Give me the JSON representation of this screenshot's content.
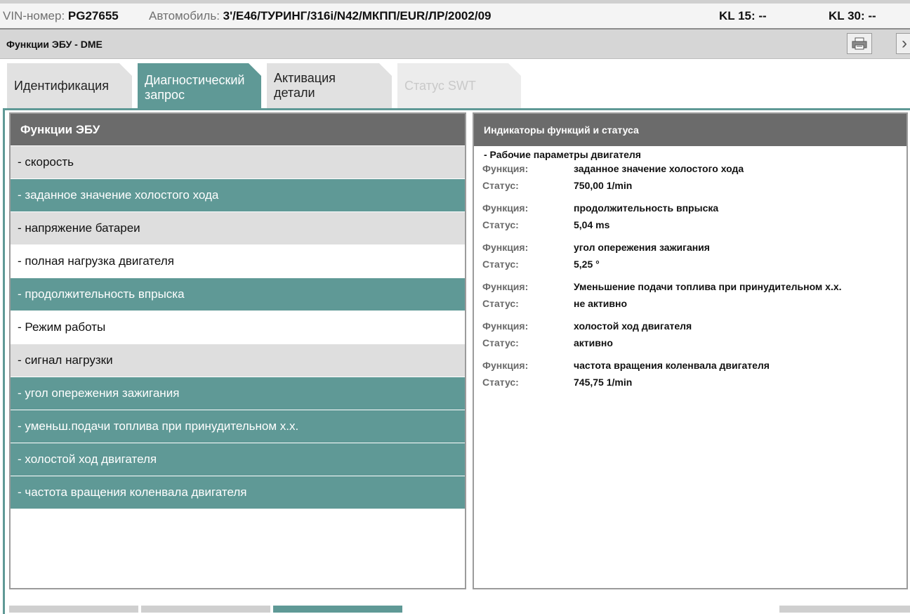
{
  "infobar": {
    "vin_label": "VIN-номер:",
    "vin_value": "PG27655",
    "car_label": "Автомобиль:",
    "car_value": "3'/E46/ТУРИНГ/316i/N42/МКПП/EUR/ЛР/2002/09",
    "kl15_label": "KL 15:",
    "kl15_value": "--",
    "kl30_label": "KL 30:",
    "kl30_value": "--"
  },
  "titlebar": {
    "title": "Функции ЭБУ - DME",
    "print_icon": "printer-icon",
    "next_icon": "chevron-right-icon"
  },
  "tabs": [
    {
      "label_line1": "Идентификация",
      "label_line2": "",
      "state": "normal"
    },
    {
      "label_line1": "Диагностический",
      "label_line2": "запрос",
      "state": "active"
    },
    {
      "label_line1": "Активация",
      "label_line2": "детали",
      "state": "normal"
    },
    {
      "label_line1": "Статус SWT",
      "label_line2": "",
      "state": "disabled"
    }
  ],
  "left_panel": {
    "header": "Функции ЭБУ",
    "items": [
      {
        "label": "- скорость",
        "state": "avail"
      },
      {
        "label": "- заданное значение холостого хода",
        "state": "sel"
      },
      {
        "label": "- напряжение батареи",
        "state": "avail"
      },
      {
        "label": "- полная нагрузка двигателя",
        "state": "plain"
      },
      {
        "label": "- продолжительность впрыска",
        "state": "sel"
      },
      {
        "label": "- Режим работы",
        "state": "plain"
      },
      {
        "label": "- сигнал нагрузки",
        "state": "avail"
      },
      {
        "label": "- угол опережения зажигания",
        "state": "sel"
      },
      {
        "label": "- уменьш.подачи топлива при принудительном х.х.",
        "state": "sel"
      },
      {
        "label": "- холостой ход двигателя",
        "state": "sel"
      },
      {
        "label": "- частота вращения коленвала двигателя",
        "state": "sel"
      }
    ]
  },
  "right_panel": {
    "header": "Индикаторы функций и статуса",
    "group_title": "- Рабочие параметры двигателя",
    "function_label": "Функция:",
    "status_label": "Статус:",
    "entries": [
      {
        "function": "заданное значение холостого хода",
        "status": "750,00  1/min"
      },
      {
        "function": "продолжительность впрыска",
        "status": "5,04  ms"
      },
      {
        "function": "угол опережения зажигания",
        "status": "5,25  °"
      },
      {
        "function": "Уменьшение подачи топлива при принудительном х.х.",
        "status": "не активно"
      },
      {
        "function": "холостой ход двигателя",
        "status": "активно"
      },
      {
        "function": "частота вращения коленвала двигателя",
        "status": "745,75  1/min"
      }
    ]
  },
  "colors": {
    "accent": "#5f9996",
    "header_gray": "#6b6b6b",
    "available_gray": "#dedede"
  }
}
